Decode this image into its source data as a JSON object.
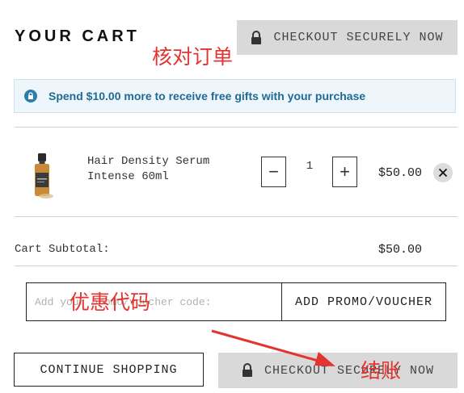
{
  "header": {
    "title": "YOUR CART",
    "checkout_top_label": "CHECKOUT SECURELY NOW"
  },
  "banner": {
    "text": "Spend $10.00 more to receive free gifts with your purchase",
    "icon": "info-icon"
  },
  "cart": {
    "items": [
      {
        "name": "Hair Density Serum Intense 60ml",
        "quantity": "1",
        "price": "$50.00",
        "decrement_label": "−",
        "increment_label": "+"
      }
    ],
    "subtotal_label": "Cart Subtotal:",
    "subtotal_value": "$50.00"
  },
  "promo": {
    "placeholder": "Add your promo/voucher code:",
    "button_label": "ADD PROMO/VOUCHER"
  },
  "footer": {
    "continue_label": "CONTINUE SHOPPING",
    "checkout_bottom_label": "CHECKOUT SECURELY NOW"
  },
  "annotations": {
    "review_order": "核对订单",
    "promo_code": "优惠代码",
    "checkout": "结账"
  },
  "colors": {
    "annotation_red": "#e3342f",
    "banner_text": "#1f6b93",
    "banner_icon": "#2c7ea8",
    "button_grey": "#d9d9d9"
  }
}
